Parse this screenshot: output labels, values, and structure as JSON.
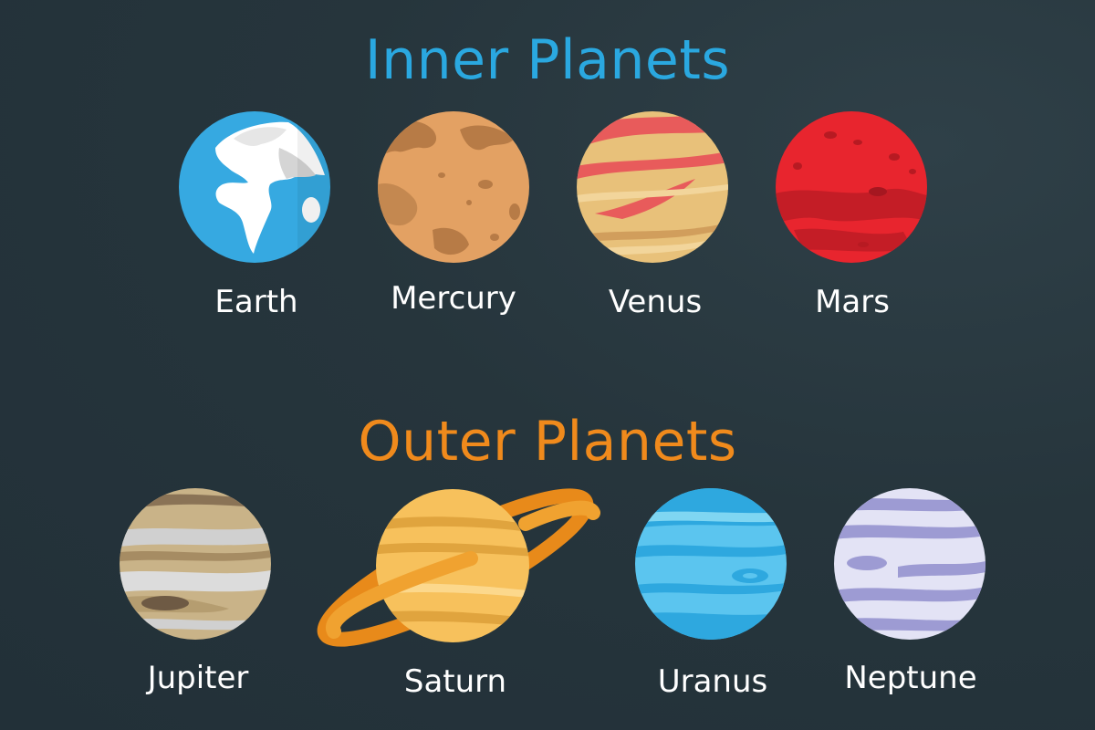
{
  "inner": {
    "heading": "Inner Planets",
    "planets": [
      {
        "name": "Earth"
      },
      {
        "name": "Mercury"
      },
      {
        "name": "Venus"
      },
      {
        "name": "Mars"
      }
    ]
  },
  "outer": {
    "heading": "Outer Planets",
    "planets": [
      {
        "name": "Jupiter"
      },
      {
        "name": "Saturn"
      },
      {
        "name": "Uranus"
      },
      {
        "name": "Neptune"
      }
    ]
  },
  "colors": {
    "background": "#26353c",
    "inner_heading": "#2aa8e0",
    "outer_heading": "#f08a1c",
    "label": "#ffffff"
  }
}
